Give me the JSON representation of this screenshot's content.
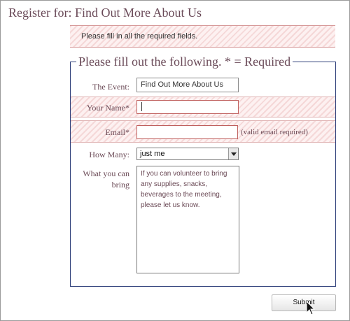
{
  "page": {
    "title": "Register for: Find Out More About Us"
  },
  "error": {
    "message": "Please fill in all the required fields."
  },
  "form": {
    "legend": "Please fill out the following. * = Required",
    "event": {
      "label": "The Event:",
      "value": "Find Out More About Us"
    },
    "name": {
      "label": "Your Name*",
      "value": ""
    },
    "email": {
      "label": "Email*",
      "value": "",
      "hint": "(valid email required)"
    },
    "how_many": {
      "label": "How Many:",
      "selected": "just me"
    },
    "bring": {
      "label_line1": "What you can",
      "label_line2": "bring",
      "placeholder_line1": "If you can volunteer to bring",
      "placeholder_line2": "any supplies, snacks,",
      "placeholder_line3": "beverages to the meeting,",
      "placeholder_line4": "please let us know."
    },
    "submit_label": "Submit"
  },
  "colors": {
    "text": "#6b4a56",
    "fieldset_border": "#2e3f7a",
    "error_input_border": "#c0605e",
    "hatch": "#fdf1f1"
  },
  "icons": [
    "mouse-pointer-icon",
    "dropdown-arrow-icon"
  ]
}
